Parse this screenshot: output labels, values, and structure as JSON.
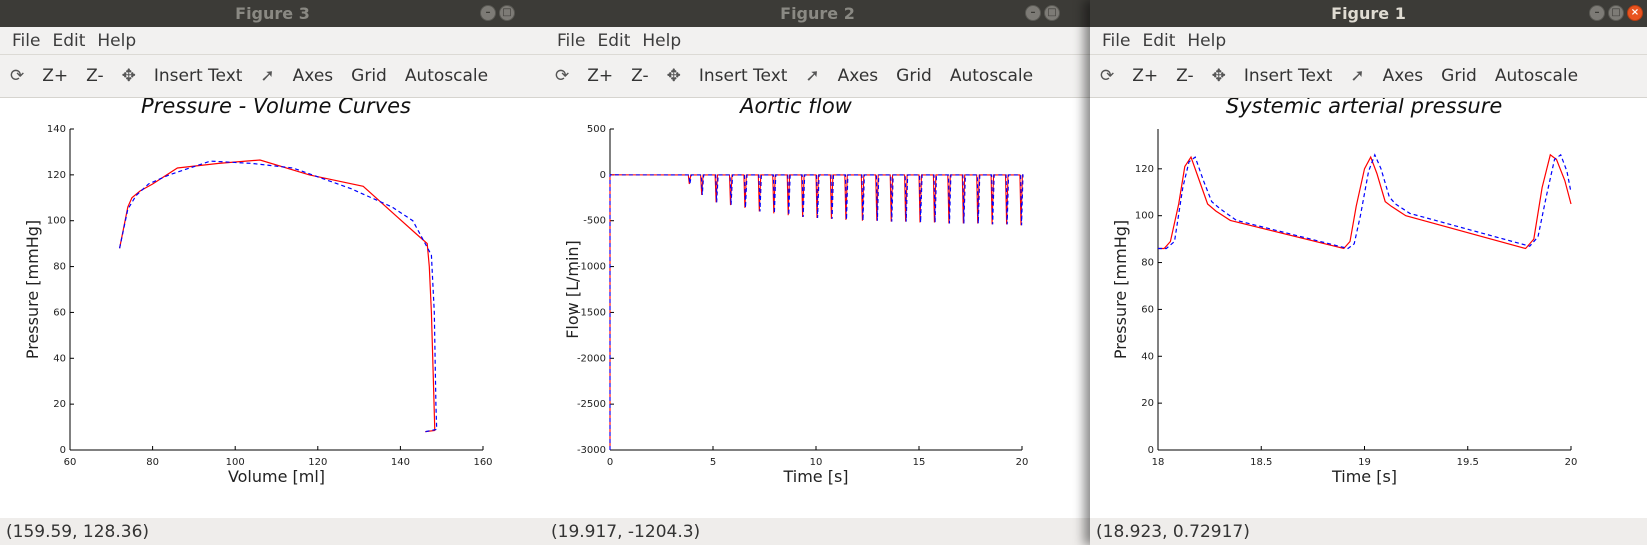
{
  "windows": [
    {
      "id": "w3",
      "title": "Figure 3",
      "active": false,
      "menu": [
        "File",
        "Edit",
        "Help"
      ],
      "toolbar": {
        "zoom_in": "Z+",
        "zoom_out": "Z-",
        "insert_text": "Insert Text",
        "axes": "Axes",
        "grid": "Grid",
        "autoscale": "Autoscale"
      },
      "status": "(159.59, 128.36)"
    },
    {
      "id": "w2",
      "title": "Figure 2",
      "active": false,
      "menu": [
        "File",
        "Edit",
        "Help"
      ],
      "toolbar": {
        "zoom_in": "Z+",
        "zoom_out": "Z-",
        "insert_text": "Insert Text",
        "axes": "Axes",
        "grid": "Grid",
        "autoscale": "Autoscale"
      },
      "status": "(19.917, -1204.3)"
    },
    {
      "id": "w1",
      "title": "Figure 1",
      "active": true,
      "menu": [
        "File",
        "Edit",
        "Help"
      ],
      "toolbar": {
        "zoom_in": "Z+",
        "zoom_out": "Z-",
        "insert_text": "Insert Text",
        "axes": "Axes",
        "grid": "Grid",
        "autoscale": "Autoscale"
      },
      "status": "(18.923, 0.72917)"
    }
  ],
  "icons": {
    "rotate": "rotate-icon",
    "pan": "pan-icon",
    "select": "pointer-icon"
  },
  "colors": {
    "series1": "#ff0000",
    "series2": "#0000ff",
    "titlebar": "#3c3b37",
    "close": "#e95420"
  },
  "chart_data": [
    {
      "window": "w3",
      "type": "line",
      "title": "Pressure - Volume Curves",
      "xlabel": "Volume [ml]",
      "ylabel": "Pressure [mmHg]",
      "xlim": [
        60,
        160
      ],
      "ylim": [
        0,
        140
      ],
      "xticks": [
        60,
        80,
        100,
        120,
        140,
        160
      ],
      "yticks": [
        0,
        20,
        40,
        60,
        80,
        100,
        120,
        140
      ],
      "series": [
        {
          "style": "solid",
          "color": "#ff0000",
          "points": [
            [
              72,
              88
            ],
            [
              74,
              106
            ],
            [
              75,
              110
            ],
            [
              77,
              113
            ],
            [
              80,
              116
            ],
            [
              86,
              123
            ],
            [
              96,
              125
            ],
            [
              106,
              126.5
            ],
            [
              118,
              120
            ],
            [
              131,
              115
            ],
            [
              139,
              102
            ],
            [
              144,
              94
            ],
            [
              146.5,
              90
            ],
            [
              147,
              80
            ],
            [
              147.5,
              60
            ],
            [
              148,
              30
            ],
            [
              148.3,
              10
            ],
            [
              148.3,
              8.5
            ],
            [
              146,
              8
            ]
          ]
        },
        {
          "style": "dashed",
          "color": "#0000ff",
          "points": [
            [
              72,
              88
            ],
            [
              74,
              105
            ],
            [
              76,
              111
            ],
            [
              79,
              116
            ],
            [
              84,
              120
            ],
            [
              94,
              126
            ],
            [
              104,
              125
            ],
            [
              114,
              123
            ],
            [
              128,
              114
            ],
            [
              138,
              106
            ],
            [
              143,
              100
            ],
            [
              146,
              90
            ],
            [
              147.5,
              85
            ],
            [
              148.2,
              60
            ],
            [
              148.6,
              20
            ],
            [
              148.8,
              9
            ],
            [
              146,
              8
            ]
          ]
        }
      ]
    },
    {
      "window": "w2",
      "type": "line",
      "title": "Aortic flow",
      "xlabel": "Time [s]",
      "ylabel": "Flow [L/min]",
      "xlim": [
        0,
        20
      ],
      "ylim": [
        -3000,
        500
      ],
      "xticks": [
        0,
        5,
        10,
        15,
        20
      ],
      "yticks": [
        500,
        0,
        -500,
        -1000,
        -1500,
        -2000,
        -2500,
        -3000
      ],
      "baseline": 0,
      "initial_drop": -3000,
      "spike_times": [
        3.8,
        4.4,
        5.1,
        5.8,
        6.5,
        7.2,
        7.9,
        8.6,
        9.3,
        10.0,
        10.7,
        11.4,
        12.2,
        12.9,
        13.6,
        14.3,
        15.0,
        15.7,
        16.4,
        17.1,
        17.8,
        18.5,
        19.2,
        19.9
      ],
      "spike_depths": [
        -100,
        -220,
        -300,
        -330,
        -360,
        -400,
        -420,
        -440,
        -460,
        -470,
        -480,
        -490,
        -500,
        -500,
        -510,
        -510,
        -520,
        -520,
        -530,
        -530,
        -530,
        -540,
        -540,
        -550
      ]
    },
    {
      "window": "w1",
      "type": "line",
      "title": "Systemic arterial pressure",
      "xlabel": "Time [s]",
      "ylabel": "Pressure [mmHg]",
      "xlim": [
        18,
        20
      ],
      "ylim": [
        0,
        137
      ],
      "xticks": [
        "18",
        "18.5",
        "19",
        "19.5",
        "20"
      ],
      "xtick_values": [
        18,
        18.5,
        19,
        19.5,
        20
      ],
      "yticks": [
        0,
        20,
        40,
        60,
        80,
        100,
        120
      ],
      "series": [
        {
          "style": "solid",
          "color": "#ff0000",
          "points": [
            [
              18,
              86
            ],
            [
              18.03,
              86
            ],
            [
              18.06,
              89
            ],
            [
              18.1,
              105
            ],
            [
              18.13,
              121
            ],
            [
              18.16,
              125
            ],
            [
              18.2,
              115
            ],
            [
              18.24,
              105
            ],
            [
              18.28,
              102
            ],
            [
              18.35,
              98
            ],
            [
              18.9,
              86
            ],
            [
              18.93,
              89
            ],
            [
              18.96,
              104
            ],
            [
              19.0,
              120
            ],
            [
              19.03,
              125
            ],
            [
              19.06,
              118
            ],
            [
              19.1,
              106
            ],
            [
              19.13,
              104
            ],
            [
              19.2,
              100
            ],
            [
              19.78,
              86
            ],
            [
              19.82,
              90
            ],
            [
              19.86,
              112
            ],
            [
              19.9,
              126
            ],
            [
              19.93,
              124
            ],
            [
              19.97,
              115
            ],
            [
              20,
              105
            ]
          ]
        },
        {
          "style": "dashed",
          "color": "#0000ff",
          "points": [
            [
              18,
              86
            ],
            [
              18.04,
              86
            ],
            [
              18.08,
              89
            ],
            [
              18.12,
              112
            ],
            [
              18.15,
              123
            ],
            [
              18.18,
              125
            ],
            [
              18.22,
              115
            ],
            [
              18.26,
              106
            ],
            [
              18.3,
              103
            ],
            [
              18.38,
              98
            ],
            [
              18.92,
              86
            ],
            [
              18.95,
              88
            ],
            [
              18.98,
              100
            ],
            [
              19.02,
              119
            ],
            [
              19.05,
              126
            ],
            [
              19.08,
              120
            ],
            [
              19.12,
              108
            ],
            [
              19.15,
              105
            ],
            [
              19.22,
              101
            ],
            [
              19.8,
              87
            ],
            [
              19.84,
              91
            ],
            [
              19.88,
              108
            ],
            [
              19.92,
              124
            ],
            [
              19.95,
              126
            ],
            [
              19.98,
              119
            ],
            [
              20,
              110
            ]
          ]
        }
      ]
    }
  ]
}
